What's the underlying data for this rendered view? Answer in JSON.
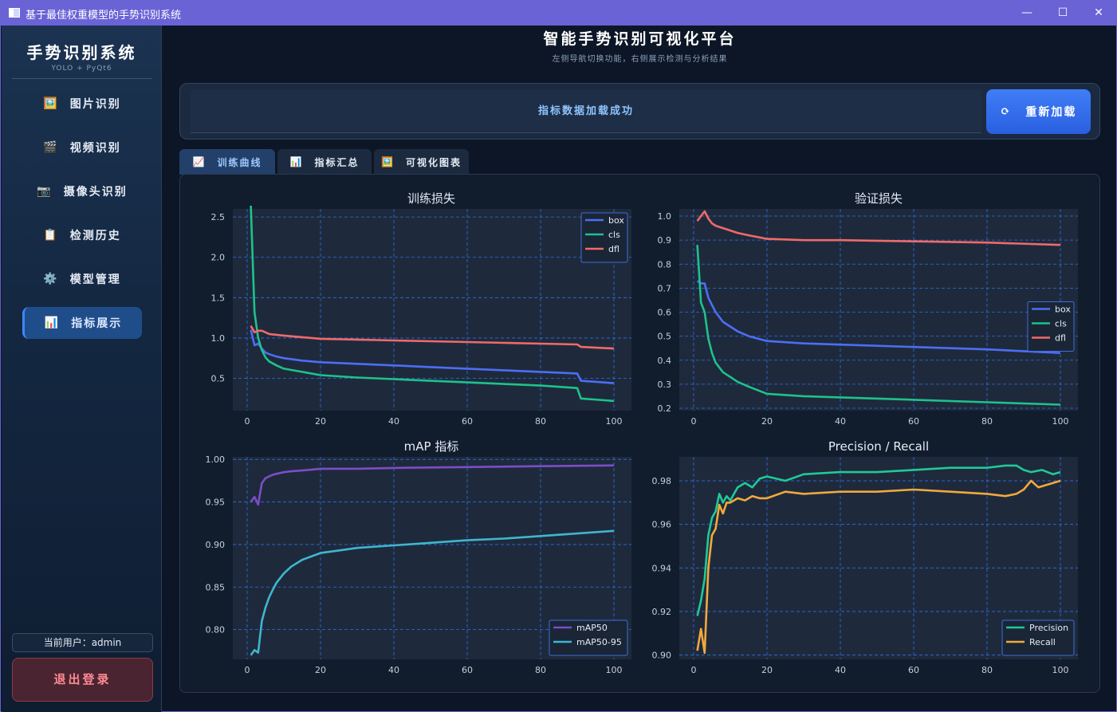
{
  "window": {
    "title": "基于最佳权重模型的手势识别系统",
    "min_icon": "minimize-icon",
    "max_icon": "maximize-icon",
    "close_icon": "close-icon"
  },
  "sidebar": {
    "brand": "手势识别系统",
    "brand_sub": "YOLO + PyQt6",
    "items": [
      {
        "label": "图片识别",
        "icon": "🖼️"
      },
      {
        "label": "视频识别",
        "icon": "🎬"
      },
      {
        "label": "摄像头识别",
        "icon": "📷"
      },
      {
        "label": "检测历史",
        "icon": "📋"
      },
      {
        "label": "模型管理",
        "icon": "⚙️"
      },
      {
        "label": "指标展示",
        "icon": "📊"
      }
    ],
    "active_index": 5,
    "user_text": "当前用户：admin",
    "logout_label": "退出登录"
  },
  "header": {
    "title": "智能手势识别可视化平台",
    "subtitle": "左侧导航切换功能，右侧展示检测与分析结果"
  },
  "status": {
    "message": "指标数据加载成功",
    "reload_label": "重新加载",
    "reload_icon": "⟳"
  },
  "tabs": [
    {
      "label": "训练曲线",
      "icon": "📈"
    },
    {
      "label": "指标汇总",
      "icon": "📊"
    },
    {
      "label": "可视化图表",
      "icon": "🖼️"
    }
  ],
  "colors": {
    "box": "#4c6ef5",
    "cls": "#1ec28b",
    "dfl": "#f06a6a",
    "map50": "#7d4dc7",
    "map5095": "#3fb6cf",
    "precision": "#20c997",
    "recall": "#f2a93b",
    "grid": "#2f6fe0",
    "plot_bg": "#1e2a3c"
  },
  "chart_data": [
    {
      "type": "line",
      "title": "训练损失",
      "xlim": [
        0,
        100
      ],
      "ylim": [
        0.1,
        2.6
      ],
      "xticks": [
        0,
        20,
        40,
        60,
        80,
        100
      ],
      "yticks": [
        0.5,
        1.0,
        1.5,
        2.0,
        2.5
      ],
      "legend": "top-right",
      "series": [
        {
          "name": "box",
          "x": [
            1,
            2,
            3,
            4,
            5,
            6,
            8,
            10,
            15,
            20,
            30,
            40,
            50,
            60,
            70,
            80,
            90,
            91,
            100
          ],
          "y": [
            1.1,
            0.91,
            0.93,
            0.87,
            0.82,
            0.8,
            0.77,
            0.75,
            0.72,
            0.7,
            0.68,
            0.66,
            0.64,
            0.62,
            0.6,
            0.58,
            0.56,
            0.47,
            0.44
          ]
        },
        {
          "name": "cls",
          "x": [
            1,
            2,
            3,
            4,
            5,
            6,
            8,
            10,
            15,
            20,
            30,
            40,
            50,
            60,
            70,
            80,
            90,
            91,
            100
          ],
          "y": [
            2.64,
            1.32,
            1.0,
            0.85,
            0.76,
            0.71,
            0.66,
            0.62,
            0.58,
            0.54,
            0.51,
            0.49,
            0.47,
            0.45,
            0.43,
            0.41,
            0.38,
            0.25,
            0.22
          ]
        },
        {
          "name": "dfl",
          "x": [
            1,
            2,
            3,
            4,
            5,
            6,
            8,
            10,
            15,
            20,
            30,
            40,
            50,
            60,
            70,
            80,
            90,
            91,
            100
          ],
          "y": [
            1.15,
            1.07,
            1.09,
            1.09,
            1.07,
            1.05,
            1.04,
            1.03,
            1.01,
            0.99,
            0.98,
            0.97,
            0.96,
            0.95,
            0.94,
            0.93,
            0.92,
            0.89,
            0.87
          ]
        }
      ]
    },
    {
      "type": "line",
      "title": "验证损失",
      "xlim": [
        0,
        100
      ],
      "ylim": [
        0.19,
        1.03
      ],
      "xticks": [
        0,
        20,
        40,
        60,
        80,
        100
      ],
      "yticks": [
        0.2,
        0.3,
        0.4,
        0.5,
        0.6,
        0.7,
        0.8,
        0.9,
        1.0
      ],
      "legend": "center-right",
      "series": [
        {
          "name": "box",
          "x": [
            1,
            2,
            3,
            4,
            5,
            6,
            8,
            10,
            12,
            15,
            20,
            30,
            40,
            60,
            80,
            100
          ],
          "y": [
            0.73,
            0.72,
            0.72,
            0.66,
            0.63,
            0.6,
            0.56,
            0.54,
            0.52,
            0.5,
            0.48,
            0.47,
            0.465,
            0.455,
            0.445,
            0.43
          ]
        },
        {
          "name": "cls",
          "x": [
            1,
            2,
            3,
            4,
            5,
            6,
            8,
            10,
            12,
            15,
            20,
            30,
            40,
            60,
            80,
            100
          ],
          "y": [
            0.88,
            0.64,
            0.6,
            0.49,
            0.43,
            0.39,
            0.35,
            0.33,
            0.31,
            0.29,
            0.26,
            0.25,
            0.245,
            0.235,
            0.225,
            0.215
          ]
        },
        {
          "name": "dfl",
          "x": [
            1,
            2,
            3,
            4,
            5,
            6,
            8,
            10,
            12,
            15,
            20,
            30,
            40,
            60,
            80,
            100
          ],
          "y": [
            0.98,
            1.0,
            1.02,
            0.99,
            0.97,
            0.96,
            0.95,
            0.94,
            0.93,
            0.92,
            0.905,
            0.9,
            0.9,
            0.895,
            0.89,
            0.88
          ]
        }
      ]
    },
    {
      "type": "line",
      "title": "mAP 指标",
      "xlim": [
        0,
        100
      ],
      "ylim": [
        0.765,
        1.003
      ],
      "xticks": [
        0,
        20,
        40,
        60,
        80,
        100
      ],
      "yticks": [
        0.8,
        0.85,
        0.9,
        0.95,
        1.0
      ],
      "legend": "bottom-right",
      "series": [
        {
          "name": "mAP50",
          "x": [
            1,
            2,
            3,
            4,
            5,
            6,
            7,
            8,
            10,
            12,
            15,
            20,
            30,
            40,
            60,
            80,
            100
          ],
          "y": [
            0.95,
            0.956,
            0.947,
            0.972,
            0.978,
            0.98,
            0.982,
            0.983,
            0.985,
            0.986,
            0.987,
            0.989,
            0.989,
            0.99,
            0.991,
            0.992,
            0.993
          ]
        },
        {
          "name": "mAP50-95",
          "x": [
            1,
            2,
            3,
            4,
            5,
            6,
            7,
            8,
            10,
            12,
            15,
            20,
            25,
            30,
            40,
            50,
            60,
            70,
            80,
            90,
            100
          ],
          "y": [
            0.77,
            0.776,
            0.773,
            0.81,
            0.826,
            0.838,
            0.847,
            0.855,
            0.866,
            0.874,
            0.882,
            0.89,
            0.893,
            0.896,
            0.899,
            0.902,
            0.905,
            0.907,
            0.91,
            0.913,
            0.916
          ]
        }
      ]
    },
    {
      "type": "line",
      "title": "Precision / Recall",
      "xlim": [
        0,
        100
      ],
      "ylim": [
        0.898,
        0.991
      ],
      "xticks": [
        0,
        20,
        40,
        60,
        80,
        100
      ],
      "yticks": [
        0.9,
        0.92,
        0.94,
        0.96,
        0.98
      ],
      "legend": "bottom-right",
      "series": [
        {
          "name": "Precision",
          "x": [
            1,
            2,
            3,
            4,
            5,
            6,
            7,
            8,
            9,
            10,
            12,
            14,
            16,
            18,
            20,
            25,
            30,
            40,
            50,
            60,
            70,
            80,
            85,
            88,
            90,
            92,
            95,
            98,
            100
          ],
          "y": [
            0.918,
            0.925,
            0.935,
            0.955,
            0.963,
            0.966,
            0.974,
            0.97,
            0.973,
            0.971,
            0.977,
            0.979,
            0.977,
            0.981,
            0.982,
            0.98,
            0.983,
            0.984,
            0.984,
            0.985,
            0.986,
            0.986,
            0.987,
            0.987,
            0.985,
            0.984,
            0.985,
            0.983,
            0.984
          ]
        },
        {
          "name": "Recall",
          "x": [
            1,
            2,
            3,
            4,
            5,
            6,
            7,
            8,
            9,
            10,
            12,
            14,
            16,
            18,
            20,
            25,
            30,
            40,
            50,
            60,
            70,
            80,
            85,
            88,
            90,
            92,
            94,
            96,
            98,
            100
          ],
          "y": [
            0.902,
            0.912,
            0.901,
            0.94,
            0.955,
            0.958,
            0.969,
            0.965,
            0.97,
            0.97,
            0.972,
            0.971,
            0.973,
            0.972,
            0.972,
            0.975,
            0.974,
            0.975,
            0.975,
            0.976,
            0.975,
            0.974,
            0.973,
            0.974,
            0.976,
            0.98,
            0.977,
            0.978,
            0.979,
            0.98
          ]
        }
      ]
    }
  ]
}
